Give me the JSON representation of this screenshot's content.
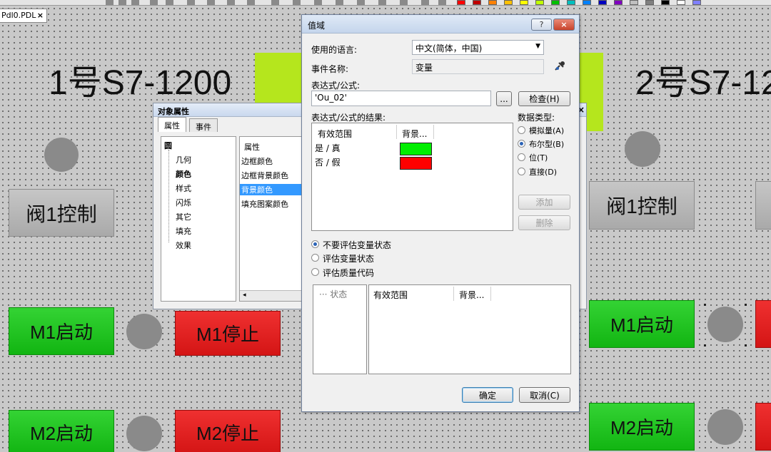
{
  "document": {
    "tab_label": "Pdl0.PDL",
    "tab_close": "×"
  },
  "canvas": {
    "station1_title": "1号S7-1200",
    "station2_title": "2号S7-12",
    "valve_left": "阀1控制",
    "valve_right": "阀1控制",
    "m1_start_left": "M1启动",
    "m1_stop_left": "M1停止",
    "m2_start_left": "M2启动",
    "m2_stop_left": "M2停止",
    "m1_start_right": "M1启动",
    "m2_start_right": "M2启动"
  },
  "toolbar": {
    "palette": [
      "#ff0000",
      "#c00000",
      "#ff8000",
      "#ffc000",
      "#ffff00",
      "#c0ff00",
      "#00c000",
      "#00c0c0",
      "#0080ff",
      "#0000c0",
      "#8000c0",
      "#c0c0c0",
      "#808080",
      "#000000",
      "#ffffff",
      "#8080ff"
    ]
  },
  "object_properties": {
    "title": "对象属性",
    "close": "×",
    "tabs": [
      "属性",
      "事件"
    ],
    "tree_root": "圆",
    "tree_items": [
      "几何",
      "颜色",
      "样式",
      "闪烁",
      "其它",
      "填充",
      "效果"
    ],
    "attr_header": "属性",
    "attributes": [
      "边框颜色",
      "边框背景颜色",
      "背景颜色",
      "填充图案颜色"
    ],
    "selected_attribute": "背景颜色"
  },
  "dialog": {
    "title": "值域",
    "help_label": "?",
    "close_label": "×",
    "language_label": "使用的语言:",
    "language_value": "中文(简体，中国)",
    "event_name_label": "事件名称:",
    "event_name_value": "变量",
    "expression_label": "表达式/公式:",
    "expression_value": "'Ou_02'",
    "browse_label": "...",
    "check_label": "检查(H)",
    "results_label": "表达式/公式的结果:",
    "results_headers": [
      "有效范围",
      "背景..."
    ],
    "results_rows": [
      {
        "range": "是 / 真",
        "color": "#00ee00"
      },
      {
        "range": "否 / 假",
        "color": "#ff0000"
      }
    ],
    "data_type_label": "数据类型:",
    "data_types": [
      "模拟量(A)",
      "布尔型(B)",
      "位(T)",
      "直接(D)"
    ],
    "selected_data_type": "布尔型(B)",
    "add_label": "添加",
    "delete_label": "删除",
    "eval_options": [
      "不要评估变量状态",
      "评估变量状态",
      "评估质量代码"
    ],
    "selected_eval_option": "不要评估变量状态",
    "status_tree_item": "状态",
    "status_headers": [
      "有效范围",
      "背景..."
    ],
    "ok_label": "确定",
    "cancel_label": "取消(C)"
  }
}
